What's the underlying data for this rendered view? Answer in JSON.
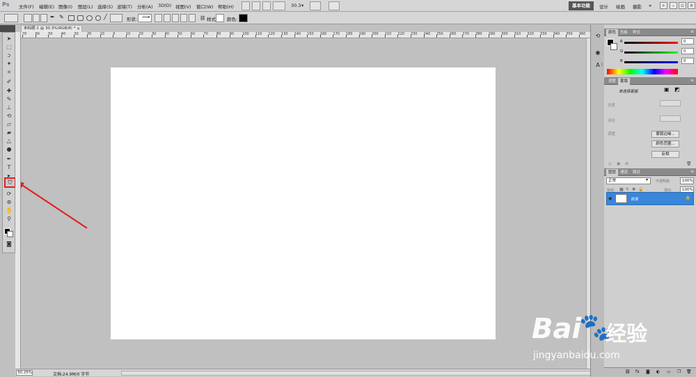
{
  "app": {
    "logo": "Ps"
  },
  "menu": [
    "文件(F)",
    "编辑(E)",
    "图像(I)",
    "图层(L)",
    "选择(S)",
    "滤镜(T)",
    "分析(A)",
    "3D(D)",
    "视图(V)",
    "窗口(W)",
    "帮助(H)"
  ],
  "menubar": {
    "zoom": "30.3",
    "workspaces": [
      "基本功能",
      "设计",
      "绘画",
      "摄影"
    ],
    "more": "»"
  },
  "options": {
    "shape_label": "形状:",
    "style_label": "样式:",
    "color_label": "颜色:"
  },
  "document": {
    "tab_title": "未标题-1 @ 30.3%(RGB/8) *",
    "close": "×"
  },
  "ruler_labels": [
    "70",
    "60",
    "50",
    "40",
    "30",
    "20",
    "10",
    "0",
    "10",
    "20",
    "30",
    "40",
    "50",
    "60",
    "70",
    "80",
    "90",
    "100",
    "110",
    "120",
    "130",
    "140",
    "150",
    "160",
    "170",
    "180",
    "190",
    "200",
    "210",
    "220",
    "230",
    "240",
    "250",
    "260",
    "270",
    "280",
    "290",
    "300",
    "310",
    "320",
    "330",
    "340",
    "350",
    "360"
  ],
  "status": {
    "zoom": "30.25%",
    "doc_info": "文档:24.9M/0 字节"
  },
  "color_panel": {
    "tabs": [
      "颜色",
      "色板",
      "样式"
    ],
    "labels": [
      "R",
      "G",
      "B"
    ],
    "values": [
      "0",
      "0",
      "0"
    ]
  },
  "adjust_panel": {
    "tabs": [
      "调整",
      "蒙版"
    ],
    "title": "未选择蒙版",
    "rows": [
      "浓度",
      "羽化",
      "调整"
    ],
    "buttons": [
      "蒙版边缘...",
      "颜色范围...",
      "反相"
    ]
  },
  "layers_panel": {
    "tabs": [
      "图层",
      "通道",
      "路径"
    ],
    "blend_mode": "正常",
    "opacity_label": "不透明度:",
    "opacity": "100%",
    "lock_label": "锁定:",
    "fill_label": "填充:",
    "fill": "100%",
    "layer_name": "背景"
  },
  "watermark": {
    "brand": "Bai",
    "brand2": "经验",
    "url": "jingyanbaidu.com"
  },
  "colors": {
    "accent": "#3a86d9",
    "highlight": "#e02020",
    "workspace_active": "#555555"
  }
}
